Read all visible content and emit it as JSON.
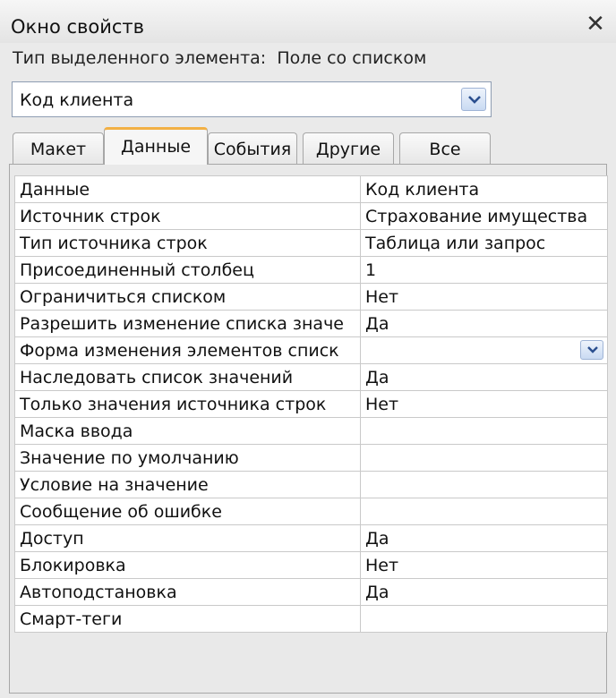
{
  "window": {
    "title": "Окно свойств",
    "close_glyph": "✕"
  },
  "selection": {
    "type_label": "Тип выделенного элемента:",
    "type_value": "Поле со списком",
    "object_name": "Код клиента"
  },
  "tabs": [
    {
      "label": "Макет",
      "active": false
    },
    {
      "label": "Данные",
      "active": true
    },
    {
      "label": "События",
      "active": false
    },
    {
      "label": "Другие",
      "active": false
    },
    {
      "label": "Все",
      "active": false
    }
  ],
  "properties": [
    {
      "name": "Данные",
      "value": "Код клиента"
    },
    {
      "name": "Источник строк",
      "value": "Страхование имущества"
    },
    {
      "name": "Тип источника строк",
      "value": "Таблица или запрос"
    },
    {
      "name": "Присоединенный столбец",
      "value": "1"
    },
    {
      "name": "Ограничиться списком",
      "value": "Нет"
    },
    {
      "name": "Разрешить изменение списка значе",
      "value": "Да"
    },
    {
      "name": "Форма изменения элементов списк",
      "value": "",
      "dropdown": true
    },
    {
      "name": "Наследовать список значений",
      "value": "Да"
    },
    {
      "name": "Только значения источника строк",
      "value": "Нет"
    },
    {
      "name": "Маска ввода",
      "value": ""
    },
    {
      "name": "Значение по умолчанию",
      "value": ""
    },
    {
      "name": "Условие на значение",
      "value": ""
    },
    {
      "name": "Сообщение об ошибке",
      "value": ""
    },
    {
      "name": "Доступ",
      "value": "Да"
    },
    {
      "name": "Блокировка",
      "value": "Нет"
    },
    {
      "name": "Автоподстановка",
      "value": "Да"
    },
    {
      "name": "Смарт-теги",
      "value": ""
    }
  ],
  "icons": {
    "dropdown": "chevron-down-icon",
    "close": "close-icon"
  },
  "colors": {
    "active_tab_accent": "#f2b045",
    "dropdown_button": "#c9daf2"
  }
}
